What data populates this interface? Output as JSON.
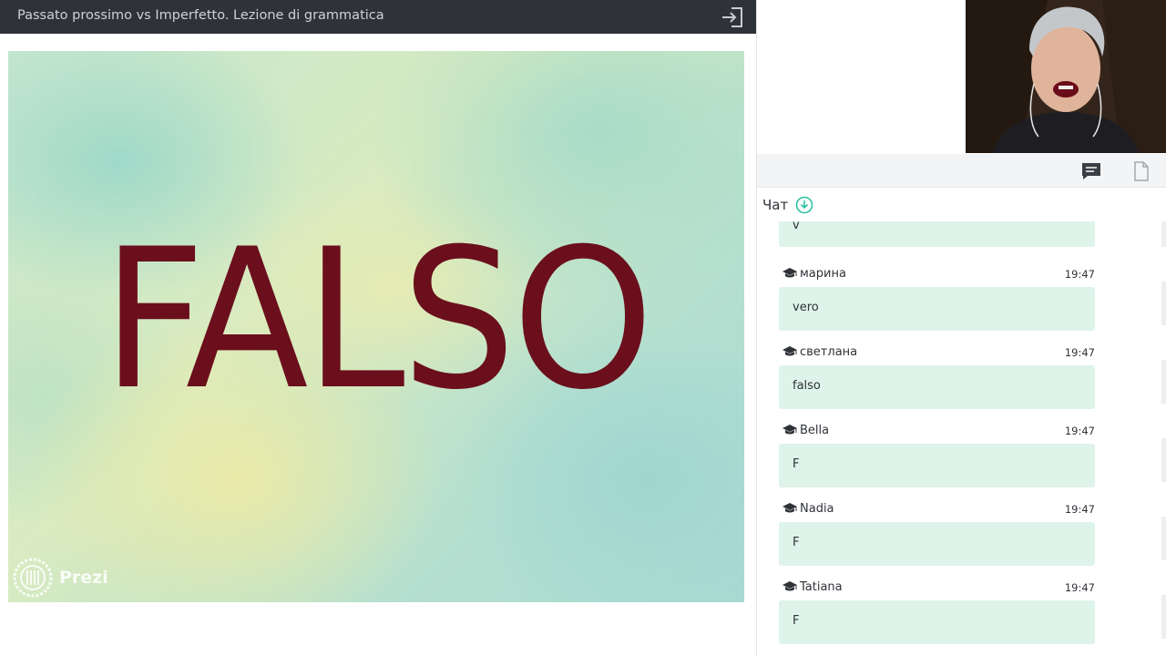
{
  "header": {
    "title": "Passato prossimo vs Imperfetto. Lezione di grammatica",
    "exit_icon": "exit-icon"
  },
  "slide": {
    "word": "FALSO",
    "word_color": "#6b0f1d",
    "watermark": "Prezi"
  },
  "tabs": {
    "chat_icon": "chat-bubble-icon",
    "file_icon": "file-icon"
  },
  "chat": {
    "title": "Чат",
    "download_icon": "download-circle-icon",
    "partial_message": "v",
    "messages": [
      {
        "author": "марина",
        "time": "19:47",
        "text": "vero"
      },
      {
        "author": "светлана",
        "time": "19:47",
        "text": "falso"
      },
      {
        "author": "Bella",
        "time": "19:47",
        "text": "F"
      },
      {
        "author": "Nadia",
        "time": "19:47",
        "text": "F"
      },
      {
        "author": "Tatiana",
        "time": "19:47",
        "text": "F"
      }
    ]
  },
  "colors": {
    "accent": "#2fc0a0",
    "bubble": "#def3ea",
    "topbar": "#2f3338"
  }
}
